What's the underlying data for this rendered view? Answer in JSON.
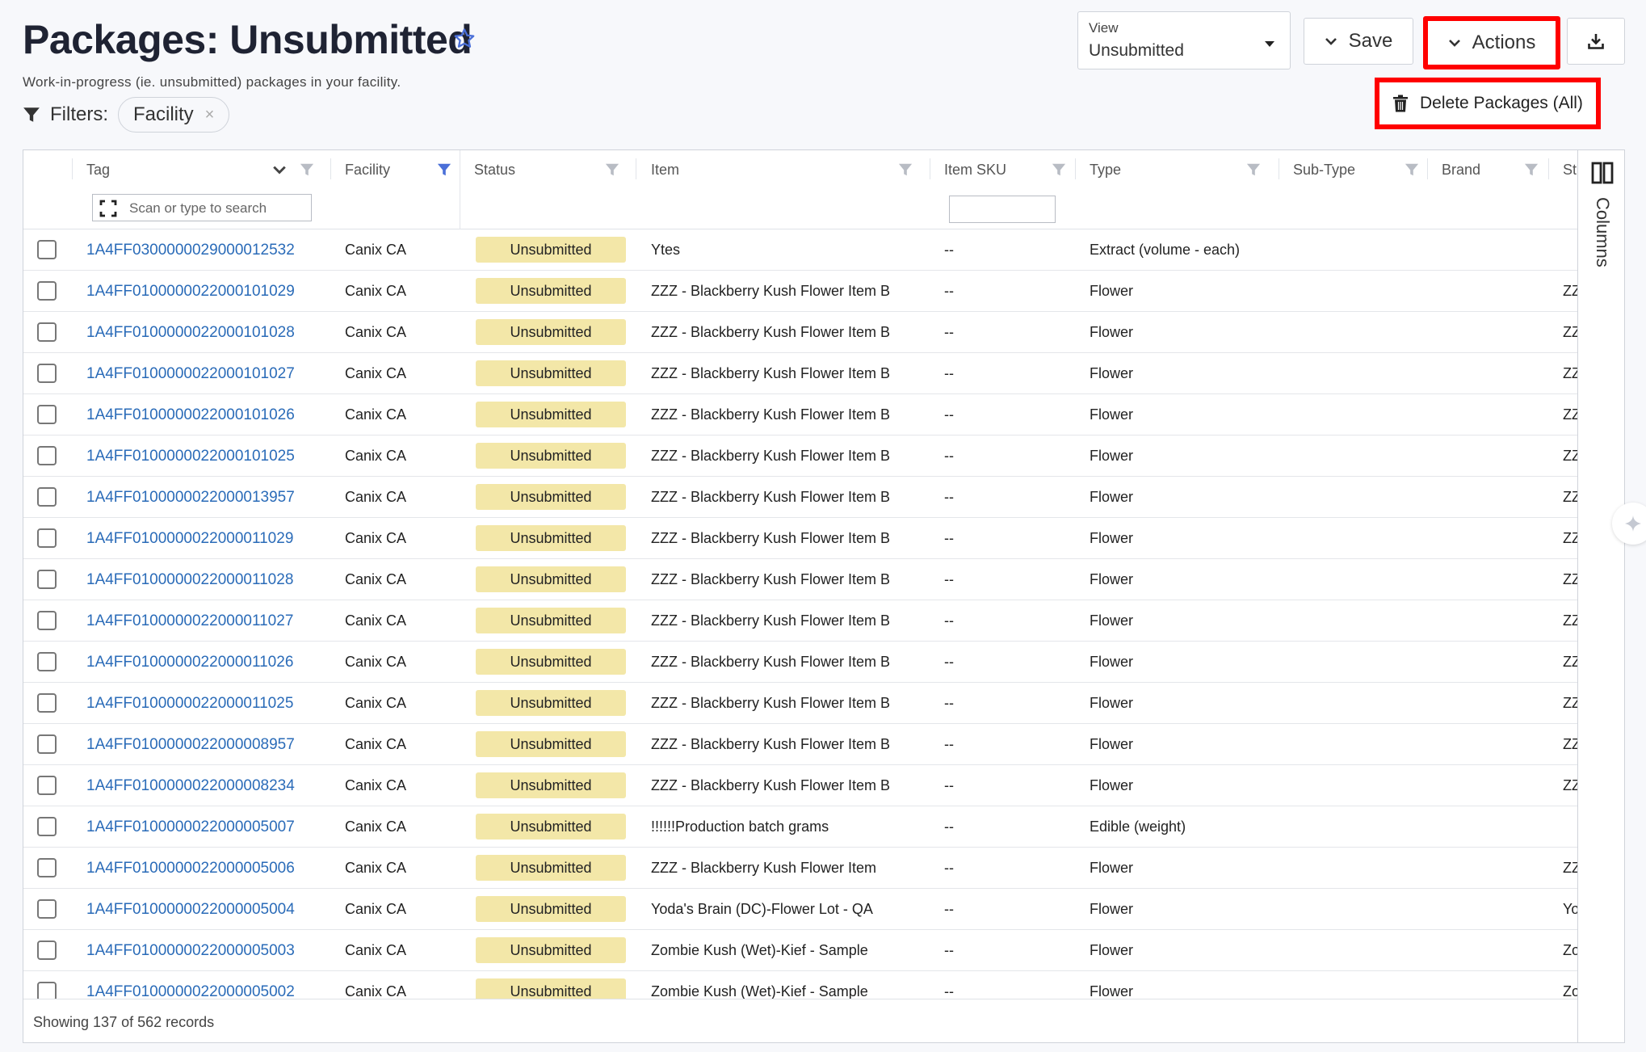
{
  "page": {
    "title": "Packages: Unsubmitted",
    "subtitle": "Work-in-progress (ie. unsubmitted) packages in your facility.",
    "filters_label": "Filters:",
    "filter_chips": [
      "Facility"
    ],
    "filter_chip_close": "×"
  },
  "toolbar": {
    "view_label": "View",
    "view_value": "Unsubmitted",
    "save_label": "Save",
    "actions_label": "Actions"
  },
  "actions_menu": {
    "items": [
      "Delete Packages (All)"
    ]
  },
  "grid": {
    "columns": [
      "Tag",
      "Facility",
      "Status",
      "Item",
      "Item SKU",
      "Type",
      "Sub-Type",
      "Brand",
      "St"
    ],
    "tag_search_placeholder": "Scan or type to search",
    "sku_filter_value": "",
    "side_panel_label": "Columns",
    "footer": "Showing 137 of 562 records",
    "rows": [
      {
        "tag": "1A4FF0300000029000012532",
        "facility": "Canix CA",
        "status": "Unsubmitted",
        "item": "Ytes",
        "sku": "--",
        "type": "Extract (volume - each)",
        "strain": ""
      },
      {
        "tag": "1A4FF0100000022000101029",
        "facility": "Canix CA",
        "status": "Unsubmitted",
        "item": "ZZZ - Blackberry Kush Flower Item B",
        "sku": "--",
        "type": "Flower",
        "strain": "ZZ"
      },
      {
        "tag": "1A4FF0100000022000101028",
        "facility": "Canix CA",
        "status": "Unsubmitted",
        "item": "ZZZ - Blackberry Kush Flower Item B",
        "sku": "--",
        "type": "Flower",
        "strain": "ZZ"
      },
      {
        "tag": "1A4FF0100000022000101027",
        "facility": "Canix CA",
        "status": "Unsubmitted",
        "item": "ZZZ - Blackberry Kush Flower Item B",
        "sku": "--",
        "type": "Flower",
        "strain": "ZZ"
      },
      {
        "tag": "1A4FF0100000022000101026",
        "facility": "Canix CA",
        "status": "Unsubmitted",
        "item": "ZZZ - Blackberry Kush Flower Item B",
        "sku": "--",
        "type": "Flower",
        "strain": "ZZ"
      },
      {
        "tag": "1A4FF0100000022000101025",
        "facility": "Canix CA",
        "status": "Unsubmitted",
        "item": "ZZZ - Blackberry Kush Flower Item B",
        "sku": "--",
        "type": "Flower",
        "strain": "ZZ"
      },
      {
        "tag": "1A4FF0100000022000013957",
        "facility": "Canix CA",
        "status": "Unsubmitted",
        "item": "ZZZ - Blackberry Kush Flower Item B",
        "sku": "--",
        "type": "Flower",
        "strain": "ZZ"
      },
      {
        "tag": "1A4FF0100000022000011029",
        "facility": "Canix CA",
        "status": "Unsubmitted",
        "item": "ZZZ - Blackberry Kush Flower Item B",
        "sku": "--",
        "type": "Flower",
        "strain": "ZZ"
      },
      {
        "tag": "1A4FF0100000022000011028",
        "facility": "Canix CA",
        "status": "Unsubmitted",
        "item": "ZZZ - Blackberry Kush Flower Item B",
        "sku": "--",
        "type": "Flower",
        "strain": "ZZ"
      },
      {
        "tag": "1A4FF0100000022000011027",
        "facility": "Canix CA",
        "status": "Unsubmitted",
        "item": "ZZZ - Blackberry Kush Flower Item B",
        "sku": "--",
        "type": "Flower",
        "strain": "ZZ"
      },
      {
        "tag": "1A4FF0100000022000011026",
        "facility": "Canix CA",
        "status": "Unsubmitted",
        "item": "ZZZ - Blackberry Kush Flower Item B",
        "sku": "--",
        "type": "Flower",
        "strain": "ZZ"
      },
      {
        "tag": "1A4FF0100000022000011025",
        "facility": "Canix CA",
        "status": "Unsubmitted",
        "item": "ZZZ - Blackberry Kush Flower Item B",
        "sku": "--",
        "type": "Flower",
        "strain": "ZZ"
      },
      {
        "tag": "1A4FF0100000022000008957",
        "facility": "Canix CA",
        "status": "Unsubmitted",
        "item": "ZZZ - Blackberry Kush Flower Item B",
        "sku": "--",
        "type": "Flower",
        "strain": "ZZ"
      },
      {
        "tag": "1A4FF0100000022000008234",
        "facility": "Canix CA",
        "status": "Unsubmitted",
        "item": "ZZZ - Blackberry Kush Flower Item B",
        "sku": "--",
        "type": "Flower",
        "strain": "ZZ"
      },
      {
        "tag": "1A4FF0100000022000005007",
        "facility": "Canix CA",
        "status": "Unsubmitted",
        "item": "!!!!!!Production batch grams",
        "sku": "--",
        "type": "Edible (weight)",
        "strain": ""
      },
      {
        "tag": "1A4FF0100000022000005006",
        "facility": "Canix CA",
        "status": "Unsubmitted",
        "item": "ZZZ - Blackberry Kush Flower Item",
        "sku": "--",
        "type": "Flower",
        "strain": "ZZ"
      },
      {
        "tag": "1A4FF0100000022000005004",
        "facility": "Canix CA",
        "status": "Unsubmitted",
        "item": "Yoda's Brain (DC)-Flower Lot - QA",
        "sku": "--",
        "type": "Flower",
        "strain": "Yo"
      },
      {
        "tag": "1A4FF0100000022000005003",
        "facility": "Canix CA",
        "status": "Unsubmitted",
        "item": "Zombie Kush (Wet)-Kief - Sample",
        "sku": "--",
        "type": "Flower",
        "strain": "Zo"
      },
      {
        "tag": "1A4FF0100000022000005002",
        "facility": "Canix CA",
        "status": "Unsubmitted",
        "item": "Zombie Kush (Wet)-Kief - Sample",
        "sku": "--",
        "type": "Flower",
        "strain": "Zo"
      }
    ]
  },
  "colors": {
    "accent_link": "#2a6bb8",
    "status_badge": "#f3e7a8",
    "highlight": "#ff0000",
    "active_filter": "#4a6fd8"
  },
  "icons": [
    "star-icon",
    "filter-icon",
    "chevron-down-icon",
    "download-icon",
    "trash-icon",
    "scan-icon",
    "columns-icon",
    "sparkle-icon"
  ]
}
